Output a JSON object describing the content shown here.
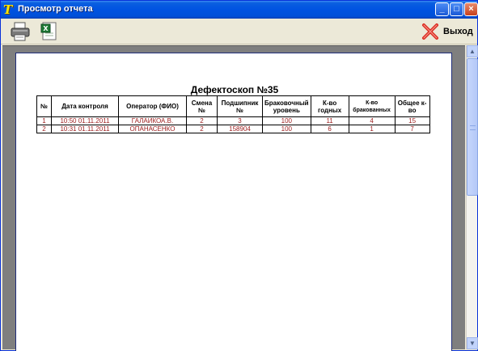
{
  "window": {
    "title": "Просмотр отчета",
    "controls": {
      "minimize": "_",
      "maximize": "□",
      "close": "×"
    }
  },
  "toolbar": {
    "print_icon": "printer-icon",
    "excel_icon": "excel-export-icon",
    "exit_label": "Выход",
    "exit_icon": "red-x-icon"
  },
  "report": {
    "title": "Дефектоскоп №35",
    "columns": [
      "№",
      "Дата контроля",
      "Оператор (ФИО)",
      "Смена №",
      "Подшипник №",
      "Браковочный уровень",
      "К-во годных",
      "К-во бракованных",
      "Общее к-во"
    ],
    "rows": [
      [
        "1",
        "10:50 01.11.2011",
        "ГАЛАИКОА.В.",
        "2",
        "3",
        "100",
        "11",
        "4",
        "15"
      ],
      [
        "2",
        "10:31 01.11.2011",
        "ОПАНАСЕНКО",
        "2",
        "158904",
        "100",
        "6",
        "1",
        "7"
      ]
    ],
    "value_color": "#9b1b1b"
  },
  "scrollbar": {
    "up": "▲",
    "down": "▼"
  }
}
